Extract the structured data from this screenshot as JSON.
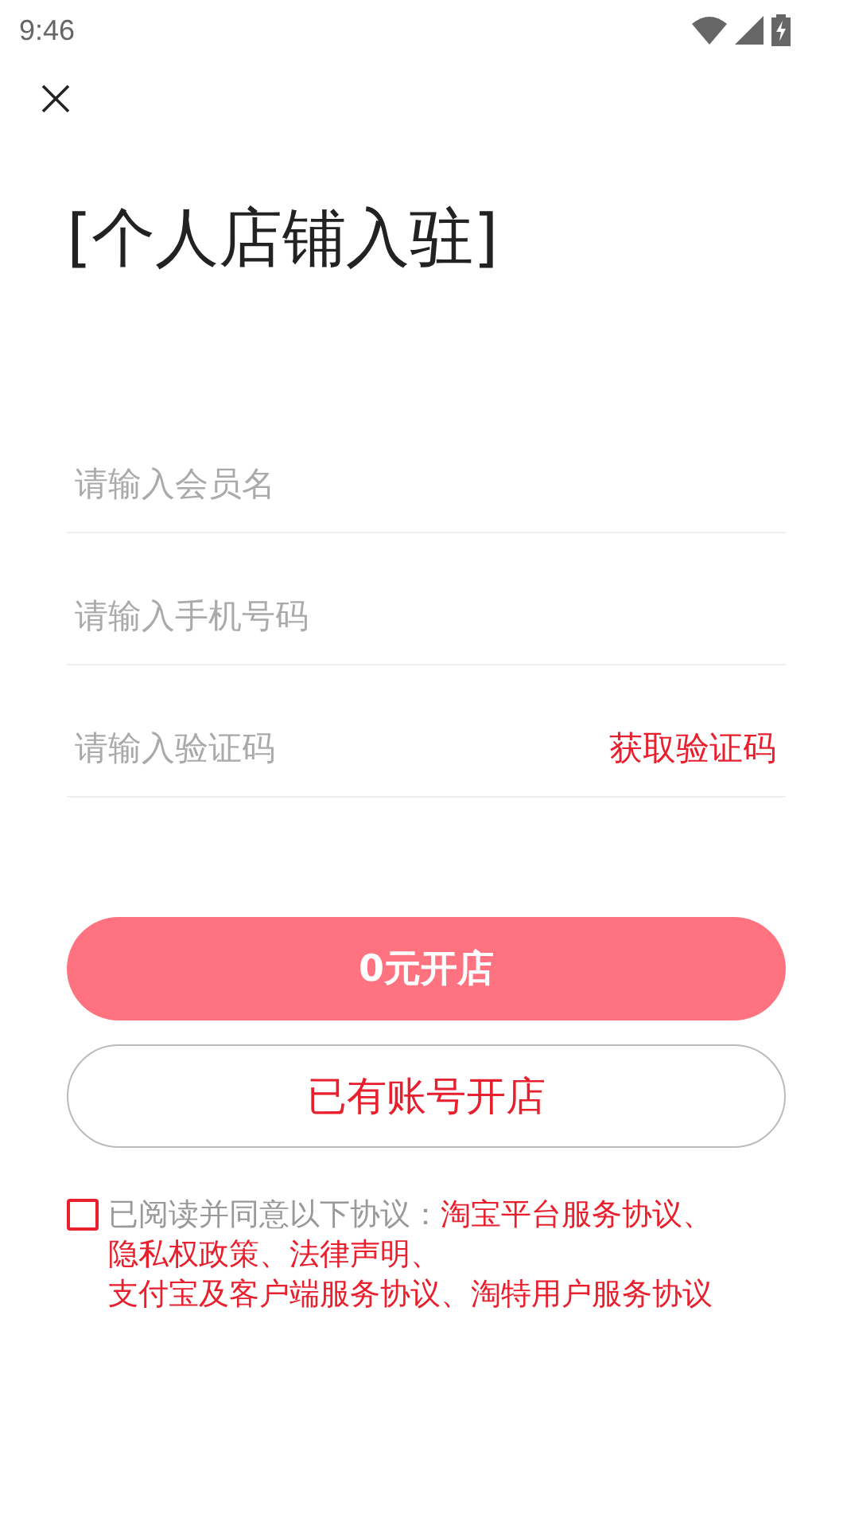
{
  "status_bar": {
    "time": "9:46"
  },
  "title": "[个人店铺入驻]",
  "fields": [
    {
      "placeholder": "请输入会员名"
    },
    {
      "placeholder": "请输入手机号码"
    },
    {
      "placeholder": "请输入验证码",
      "action": "获取验证码"
    }
  ],
  "buttons": [
    {
      "kind": "primary",
      "label": "0元开店"
    },
    {
      "kind": "outline",
      "label": "已有账号开店"
    }
  ],
  "agreement": {
    "checked": false,
    "prefix": "已阅读并同意以下协议：",
    "separator": "、",
    "links": [
      "淘宝平台服务协议",
      "隐私权政策",
      "法律声明",
      "支付宝及客户端服务协议",
      "淘特用户服务协议"
    ]
  }
}
